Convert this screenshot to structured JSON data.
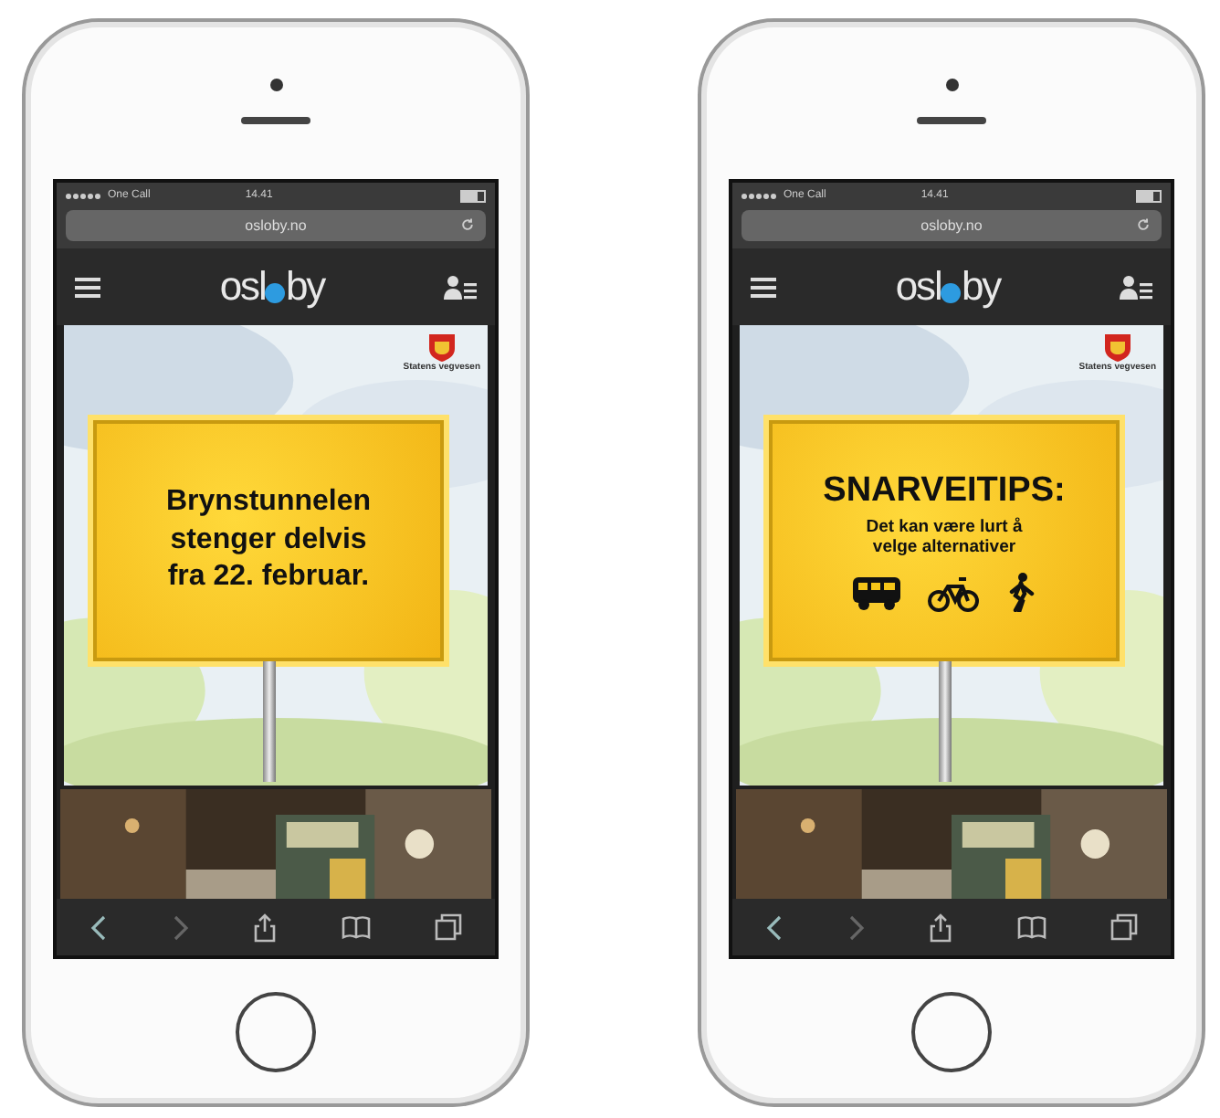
{
  "phones": [
    {
      "status": {
        "carrier": "One Call",
        "time": "14.41"
      },
      "url": "osloby.no",
      "logo": {
        "before": "osl",
        "after": "by"
      },
      "agency": "Statens vegvesen",
      "sign": {
        "kind": "notice",
        "lines": [
          "Brynstunnelen",
          "stenger delvis",
          "fra 22. februar."
        ]
      }
    },
    {
      "status": {
        "carrier": "One Call",
        "time": "14.41"
      },
      "url": "osloby.no",
      "logo": {
        "before": "osl",
        "after": "by"
      },
      "agency": "Statens vegvesen",
      "sign": {
        "kind": "tips",
        "title": "SNARVEITIPS:",
        "lines": [
          "Det kan være lurt å",
          "velge alternativer"
        ]
      }
    }
  ]
}
